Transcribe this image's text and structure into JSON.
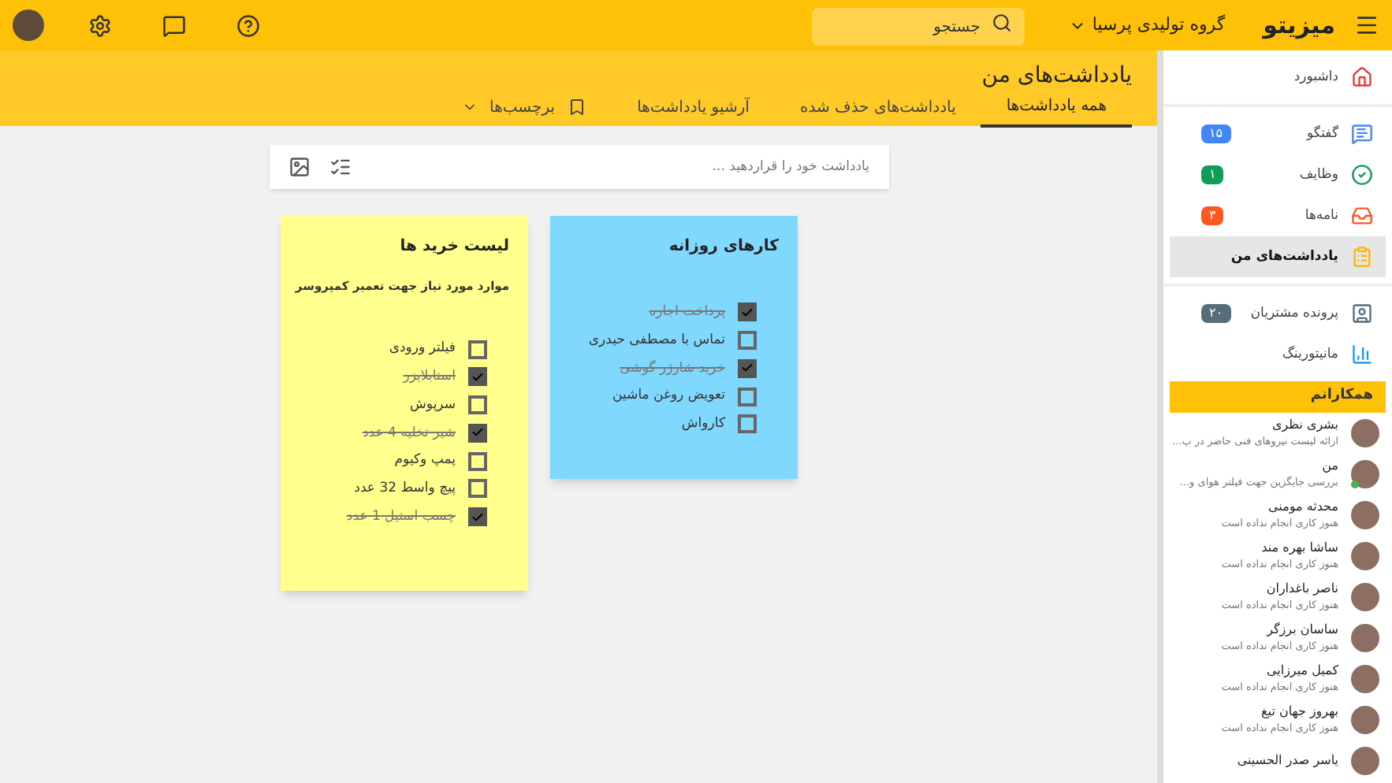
{
  "app_bar": {
    "logo": "میزیتو",
    "organization": "گروه تولیدی پرسیا",
    "search": {
      "placeholder": "جستجو"
    }
  },
  "page": {
    "title": "یادداشت‌های من",
    "tabs": [
      {
        "label": "همه یادداشت‌ها",
        "selected": true
      },
      {
        "label": "یادداشت‌های حذف شده",
        "selected": false
      },
      {
        "label": "آرشیو یادداشت‌ها",
        "selected": false
      }
    ],
    "labels_menu": "برچسب‌ها"
  },
  "composer": {
    "placeholder": "یادداشت خود را قراردهید ..."
  },
  "notes": [
    {
      "title": "کارهای روزانه",
      "color": "#80d8ff",
      "items": [
        {
          "text": "پرداخت اجاره",
          "checked": true
        },
        {
          "text": "تماس با مصطفی حیدری",
          "checked": false
        },
        {
          "text": "خرید شارژر گوشی",
          "checked": true
        },
        {
          "text": "تعویض روغن ماشین",
          "checked": false
        },
        {
          "text": "کارواش",
          "checked": false
        }
      ]
    },
    {
      "title": "لیست خرید ها",
      "color": "#ffff8d",
      "description": "موارد مورد نیاز جهت تعمیر کمپروسر",
      "items": [
        {
          "text": "فیلتر ورودی",
          "checked": false
        },
        {
          "text": "استابلایزر",
          "checked": true
        },
        {
          "text": "سرپوش",
          "checked": false
        },
        {
          "text": "شیر تخلیه 4 عدد",
          "checked": true
        },
        {
          "text": "پمپ وکیوم",
          "checked": false
        },
        {
          "text": "پیچ واسط 32 عدد",
          "checked": false
        },
        {
          "text": "چسب استیل 1 عدد",
          "checked": true
        }
      ]
    }
  ],
  "sidebar": {
    "items": [
      {
        "label": "داشبورد",
        "selected": false
      },
      {
        "label": "گفتگو",
        "badge": "۱۵",
        "color": "#4285f4",
        "selected": false
      },
      {
        "label": "وظایف",
        "badge": "۱",
        "color": "#0f9d58",
        "selected": false
      },
      {
        "label": "نامه‌ها",
        "badge": "۳",
        "color": "#ff5722",
        "selected": false
      },
      {
        "label": "یادداشت‌های من",
        "selected": true
      },
      {
        "label": "پرونده مشتریان",
        "badge": "۲۰",
        "color": "#546e7a",
        "selected": false
      },
      {
        "label": "مانیتورینگ",
        "selected": false
      }
    ],
    "colleagues_title": "همکارانم",
    "colleagues": [
      {
        "name": "بشری نظری",
        "status": "ارائه لیست نیروهای فنی حاضر در پ...",
        "online": false
      },
      {
        "name": "من",
        "status": "بررسی جایگزین جهت فیلتر هوای و...",
        "online": true
      },
      {
        "name": "محدثه مومنی",
        "status": "هنوز کاری انجام نداده است",
        "online": false
      },
      {
        "name": "ساشا بهره مند",
        "status": "هنوز کاری انجام نداده است",
        "online": false
      },
      {
        "name": "ناصر باغداران",
        "status": "هنوز کاری انجام نداده است",
        "online": false
      },
      {
        "name": "ساسان برزگر",
        "status": "هنوز کاری انجام نداده است",
        "online": false
      },
      {
        "name": "کمیل میرزایی",
        "status": "هنوز کاری انجام نداده است",
        "online": false
      },
      {
        "name": "بهروز جهان تیغ",
        "status": "هنوز کاری انجام نداده است",
        "online": false
      },
      {
        "name": "یاسر صدر الحسینی",
        "online": false
      }
    ]
  }
}
